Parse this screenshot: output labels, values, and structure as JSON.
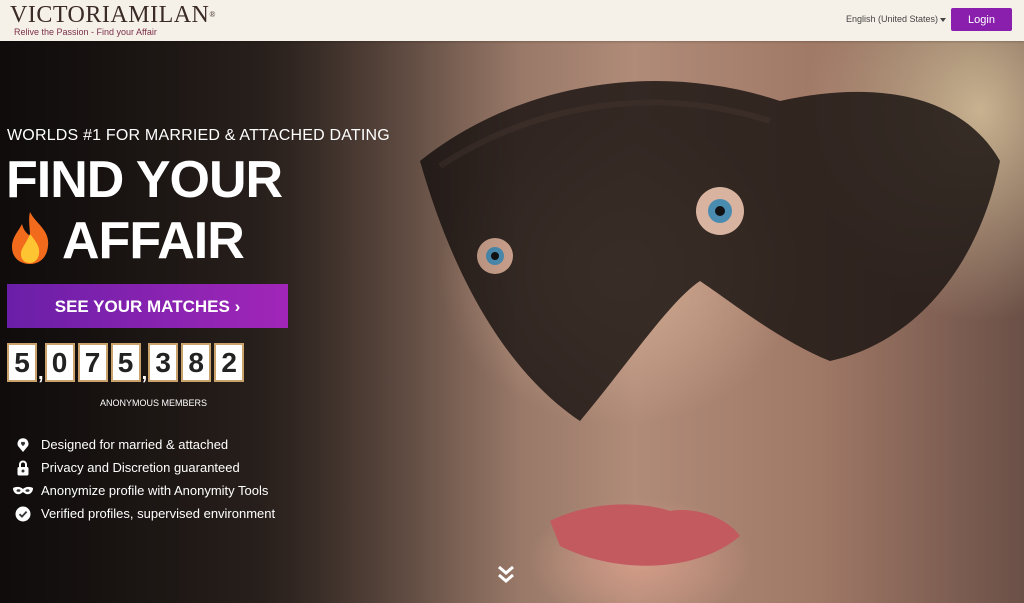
{
  "header": {
    "logo_text_part1": "VICTORIA",
    "logo_text_part2": "MILAN",
    "logo_tagline": "Relive the Passion - Find your Affair",
    "language": "English (United States)",
    "login_label": "Login",
    "accent_color": "#8a1fae"
  },
  "hero": {
    "eyebrow": "WORLDS #1 FOR MARRIED & ATTACHED DATING",
    "headline_line1": "FIND YOUR",
    "headline_line2": "AFFAIR",
    "cta_label": "SEE YOUR MATCHES",
    "cta_arrow": "›",
    "counter_digits": [
      "5",
      "0",
      "7",
      "5",
      "3",
      "8",
      "2"
    ],
    "counter_separator": ",",
    "counter_label": "ANONYMOUS MEMBERS",
    "features": [
      {
        "icon": "heart-pin-icon",
        "text": "Designed for married & attached"
      },
      {
        "icon": "lock-icon",
        "text": "Privacy and Discretion guaranteed"
      },
      {
        "icon": "mask-icon",
        "text": "Anonymize profile with Anonymity Tools"
      },
      {
        "icon": "verified-badge-icon",
        "text": "Verified profiles, supervised environment"
      }
    ],
    "scroll_icon": "chevron-double-down-icon"
  }
}
